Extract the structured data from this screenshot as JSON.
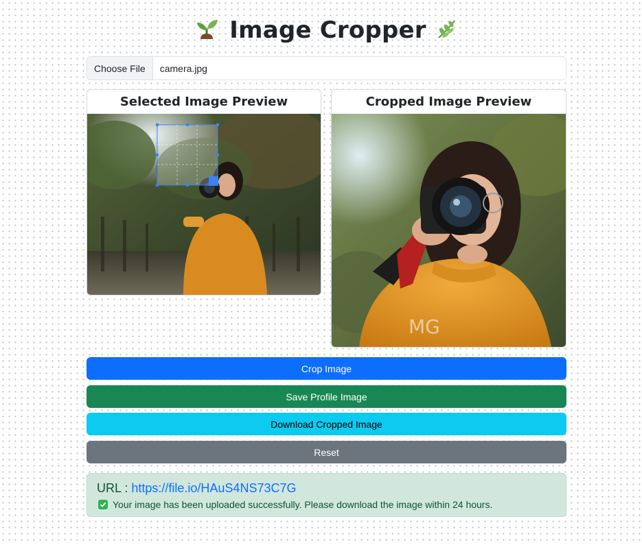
{
  "header": {
    "title": "Image Cropper",
    "left_icon": "seedling-icon",
    "right_icon": "herb-icon"
  },
  "file_input": {
    "button_label": "Choose File",
    "file_name": "camera.jpg"
  },
  "selected_preview": {
    "title": "Selected Image Preview"
  },
  "cropped_preview": {
    "title": "Cropped Image Preview"
  },
  "buttons": {
    "crop": "Crop Image",
    "save": "Save Profile Image",
    "download": "Download Cropped Image",
    "reset": "Reset"
  },
  "result": {
    "url_label": "URL :",
    "url": "https://file.io/HAuS4NS73C7G",
    "message": "Your image has been uploaded successfully. Please download the image within 24 hours."
  },
  "colors": {
    "primary": "#0d6efd",
    "success": "#198754",
    "info": "#0dcaf0",
    "secondary": "#6c757d",
    "alert_bg": "#d1e7dd"
  }
}
